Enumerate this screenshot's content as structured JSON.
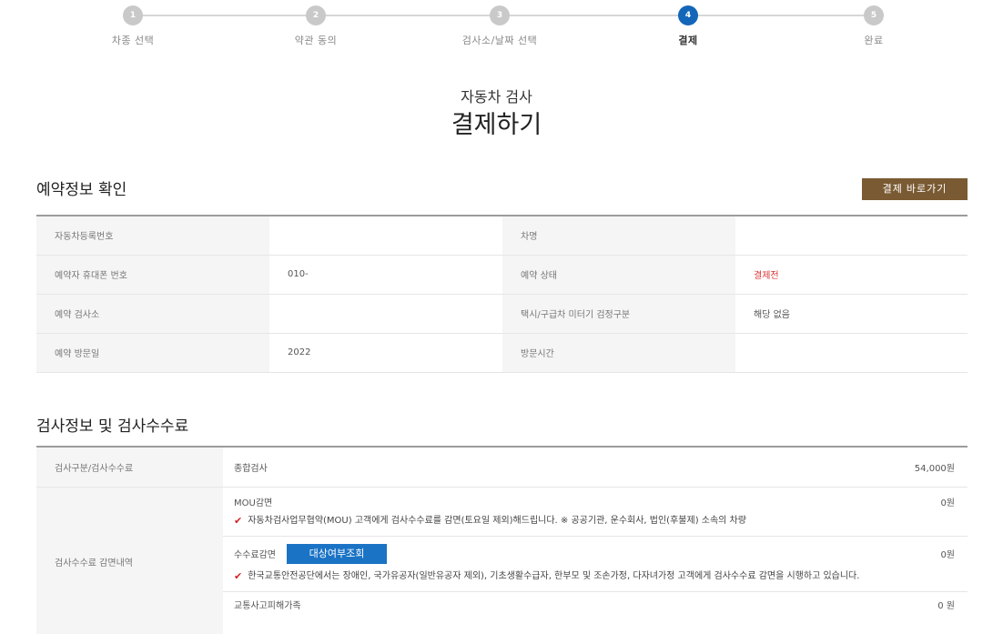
{
  "stepper": {
    "steps": [
      {
        "num": "1",
        "label": "차종 선택"
      },
      {
        "num": "2",
        "label": "약관 동의"
      },
      {
        "num": "3",
        "label": "검사소/날짜 선택"
      },
      {
        "num": "4",
        "label": "결제"
      },
      {
        "num": "5",
        "label": "완료"
      }
    ],
    "active_index": 3
  },
  "header": {
    "subtitle": "자동차 검사",
    "title": "결제하기"
  },
  "reservation": {
    "section_title": "예약정보 확인",
    "pay_button": "결제 바로가기",
    "rows": [
      {
        "label1": "자동차등록번호",
        "value1": "",
        "label2": "차명",
        "value2": ""
      },
      {
        "label1": "예약자 휴대폰 번호",
        "value1": "010-",
        "label2": "예약 상태",
        "value2": "결제전"
      },
      {
        "label1": "예약 검사소",
        "value1": "",
        "label2": "택시/구급차 미터기 검정구분",
        "value2": "해당 없음"
      },
      {
        "label1": "예약 방문일",
        "value1": "2022",
        "label2": "방문시간",
        "value2": ""
      }
    ]
  },
  "fee": {
    "section_title": "검사정보 및 검사수수료",
    "type_label": "검사구분/검사수수료",
    "type_name": "종합검사",
    "type_amount": "54,000원",
    "discount_label": "검사수수료 감면내역",
    "mou_label": "MOU감면",
    "mou_amount": "0원",
    "mou_note": "자동차검사업무협약(MOU) 고객에게 검사수수료를 감면(토요일 제외)해드립니다. ※ 공공기관, 운수회사, 법인(후불제) 소속의 차량",
    "fee_discount_label": "수수료감면",
    "target_button": "대상여부조회",
    "fee_discount_amount": "0원",
    "fee_discount_note": "한국교통안전공단에서는 장애인, 국가유공자(일반유공자 제외), 기초생활수급자, 한부모 및 조손가정, 다자녀가정 고객에게 검사수수료 감면을 시행하고 있습니다.",
    "accident_label": "교통사고피해가족",
    "accident_amount": "0 원"
  }
}
